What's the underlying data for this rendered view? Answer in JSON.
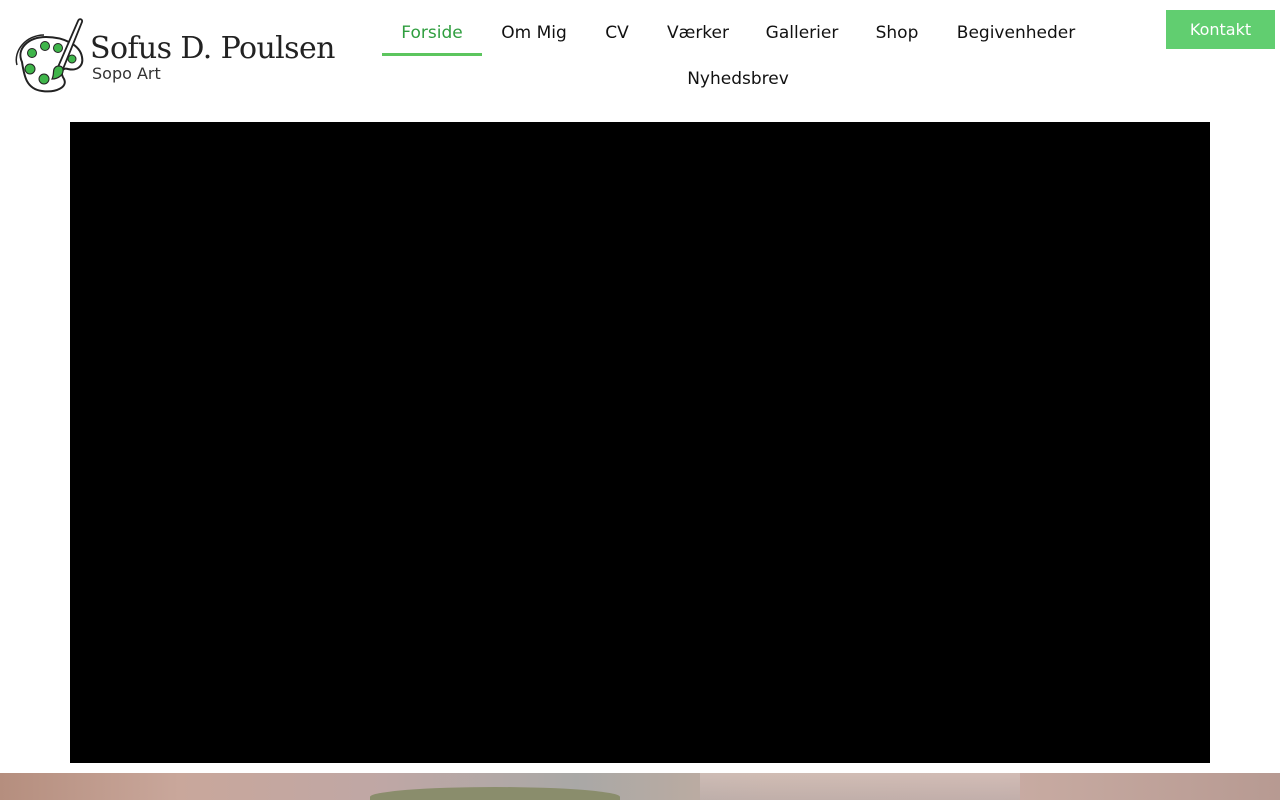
{
  "logo": {
    "title": "Sofus D. Poulsen",
    "subtitle": "Sopo Art"
  },
  "nav": {
    "items": [
      {
        "label": "Forside",
        "active": true
      },
      {
        "label": "Om Mig"
      },
      {
        "label": "CV"
      },
      {
        "label": "Værker"
      },
      {
        "label": "Gallerier"
      },
      {
        "label": "Shop"
      },
      {
        "label": "Begivenheder"
      },
      {
        "label": "Nyhedsbrev"
      }
    ]
  },
  "header": {
    "contact_label": "Kontakt"
  },
  "colors": {
    "accent": "#61ce70",
    "active_text": "#2f9e3f",
    "video_bg": "#000000"
  },
  "icons": {
    "logo": "paint-palette-icon"
  }
}
